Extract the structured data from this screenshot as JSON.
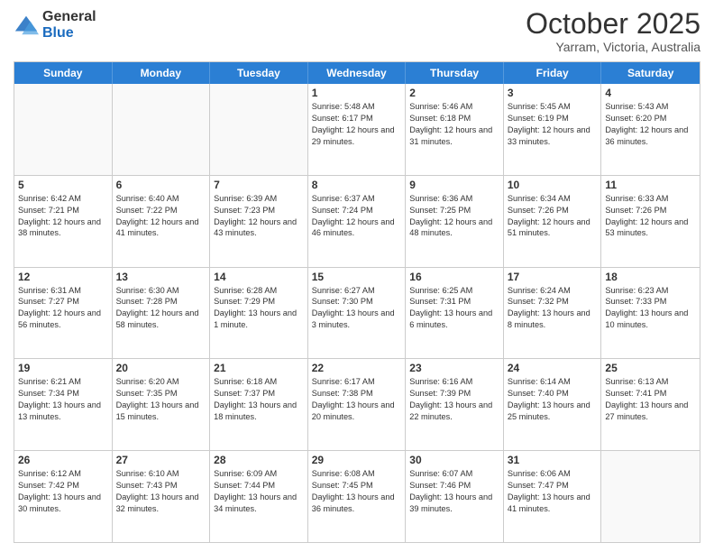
{
  "logo": {
    "general": "General",
    "blue": "Blue"
  },
  "header": {
    "month": "October 2025",
    "location": "Yarram, Victoria, Australia"
  },
  "days": {
    "headers": [
      "Sunday",
      "Monday",
      "Tuesday",
      "Wednesday",
      "Thursday",
      "Friday",
      "Saturday"
    ]
  },
  "weeks": [
    [
      {
        "num": "",
        "empty": true
      },
      {
        "num": "",
        "empty": true
      },
      {
        "num": "",
        "empty": true
      },
      {
        "num": "1",
        "rise": "5:48 AM",
        "set": "6:17 PM",
        "daylight": "12 hours and 29 minutes."
      },
      {
        "num": "2",
        "rise": "5:46 AM",
        "set": "6:18 PM",
        "daylight": "12 hours and 31 minutes."
      },
      {
        "num": "3",
        "rise": "5:45 AM",
        "set": "6:19 PM",
        "daylight": "12 hours and 33 minutes."
      },
      {
        "num": "4",
        "rise": "5:43 AM",
        "set": "6:20 PM",
        "daylight": "12 hours and 36 minutes."
      }
    ],
    [
      {
        "num": "5",
        "rise": "6:42 AM",
        "set": "7:21 PM",
        "daylight": "12 hours and 38 minutes."
      },
      {
        "num": "6",
        "rise": "6:40 AM",
        "set": "7:22 PM",
        "daylight": "12 hours and 41 minutes."
      },
      {
        "num": "7",
        "rise": "6:39 AM",
        "set": "7:23 PM",
        "daylight": "12 hours and 43 minutes."
      },
      {
        "num": "8",
        "rise": "6:37 AM",
        "set": "7:24 PM",
        "daylight": "12 hours and 46 minutes."
      },
      {
        "num": "9",
        "rise": "6:36 AM",
        "set": "7:25 PM",
        "daylight": "12 hours and 48 minutes."
      },
      {
        "num": "10",
        "rise": "6:34 AM",
        "set": "7:26 PM",
        "daylight": "12 hours and 51 minutes."
      },
      {
        "num": "11",
        "rise": "6:33 AM",
        "set": "7:26 PM",
        "daylight": "12 hours and 53 minutes."
      }
    ],
    [
      {
        "num": "12",
        "rise": "6:31 AM",
        "set": "7:27 PM",
        "daylight": "12 hours and 56 minutes."
      },
      {
        "num": "13",
        "rise": "6:30 AM",
        "set": "7:28 PM",
        "daylight": "12 hours and 58 minutes."
      },
      {
        "num": "14",
        "rise": "6:28 AM",
        "set": "7:29 PM",
        "daylight": "13 hours and 1 minute."
      },
      {
        "num": "15",
        "rise": "6:27 AM",
        "set": "7:30 PM",
        "daylight": "13 hours and 3 minutes."
      },
      {
        "num": "16",
        "rise": "6:25 AM",
        "set": "7:31 PM",
        "daylight": "13 hours and 6 minutes."
      },
      {
        "num": "17",
        "rise": "6:24 AM",
        "set": "7:32 PM",
        "daylight": "13 hours and 8 minutes."
      },
      {
        "num": "18",
        "rise": "6:23 AM",
        "set": "7:33 PM",
        "daylight": "13 hours and 10 minutes."
      }
    ],
    [
      {
        "num": "19",
        "rise": "6:21 AM",
        "set": "7:34 PM",
        "daylight": "13 hours and 13 minutes."
      },
      {
        "num": "20",
        "rise": "6:20 AM",
        "set": "7:35 PM",
        "daylight": "13 hours and 15 minutes."
      },
      {
        "num": "21",
        "rise": "6:18 AM",
        "set": "7:37 PM",
        "daylight": "13 hours and 18 minutes."
      },
      {
        "num": "22",
        "rise": "6:17 AM",
        "set": "7:38 PM",
        "daylight": "13 hours and 20 minutes."
      },
      {
        "num": "23",
        "rise": "6:16 AM",
        "set": "7:39 PM",
        "daylight": "13 hours and 22 minutes."
      },
      {
        "num": "24",
        "rise": "6:14 AM",
        "set": "7:40 PM",
        "daylight": "13 hours and 25 minutes."
      },
      {
        "num": "25",
        "rise": "6:13 AM",
        "set": "7:41 PM",
        "daylight": "13 hours and 27 minutes."
      }
    ],
    [
      {
        "num": "26",
        "rise": "6:12 AM",
        "set": "7:42 PM",
        "daylight": "13 hours and 30 minutes."
      },
      {
        "num": "27",
        "rise": "6:10 AM",
        "set": "7:43 PM",
        "daylight": "13 hours and 32 minutes."
      },
      {
        "num": "28",
        "rise": "6:09 AM",
        "set": "7:44 PM",
        "daylight": "13 hours and 34 minutes."
      },
      {
        "num": "29",
        "rise": "6:08 AM",
        "set": "7:45 PM",
        "daylight": "13 hours and 36 minutes."
      },
      {
        "num": "30",
        "rise": "6:07 AM",
        "set": "7:46 PM",
        "daylight": "13 hours and 39 minutes."
      },
      {
        "num": "31",
        "rise": "6:06 AM",
        "set": "7:47 PM",
        "daylight": "13 hours and 41 minutes."
      },
      {
        "num": "",
        "empty": true
      }
    ]
  ],
  "labels": {
    "sunrise": "Sunrise:",
    "sunset": "Sunset:",
    "daylight": "Daylight:"
  }
}
